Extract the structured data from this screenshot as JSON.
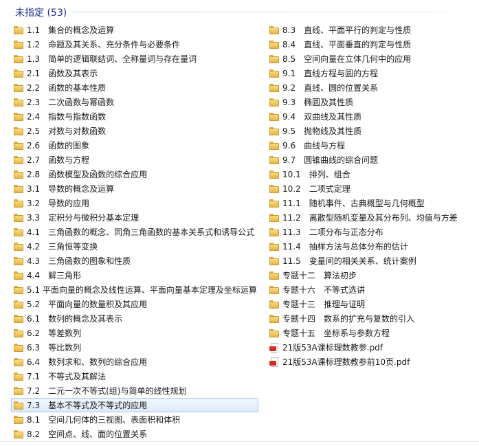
{
  "group": {
    "title": "未指定 (53)"
  },
  "left_items": [
    {
      "type": "folder",
      "label": "1.1　集合的概念及运算"
    },
    {
      "type": "folder",
      "label": "1.2　命题及其关系、充分条件与必要条件"
    },
    {
      "type": "folder",
      "label": "1.3　简单的逻辑联结词、全称量词与存在量词"
    },
    {
      "type": "folder",
      "label": "2.1　函数及其表示"
    },
    {
      "type": "folder",
      "label": "2.2　函数的基本性质"
    },
    {
      "type": "folder",
      "label": "2.3　二次函数与幂函数"
    },
    {
      "type": "folder",
      "label": "2.4　指数与指数函数"
    },
    {
      "type": "folder",
      "label": "2.5　对数与对数函数"
    },
    {
      "type": "folder",
      "label": "2.6　函数的图象"
    },
    {
      "type": "folder",
      "label": "2.7　函数与方程"
    },
    {
      "type": "folder",
      "label": "2.8　函数模型及函数的综合应用"
    },
    {
      "type": "folder",
      "label": "3.1　导数的概念及运算"
    },
    {
      "type": "folder",
      "label": "3.2　导数的应用"
    },
    {
      "type": "folder",
      "label": "3.3　定积分与微积分基本定理"
    },
    {
      "type": "folder",
      "label": "4.1　三角函数的概念、同角三角函数的基本关系式和诱导公式"
    },
    {
      "type": "folder",
      "label": "4.2　三角恒等变换"
    },
    {
      "type": "folder",
      "label": "4.3　三角函数的图象和性质"
    },
    {
      "type": "folder",
      "label": "4.4　解三角形"
    },
    {
      "type": "folder",
      "label": "5.1 平面向量的概念及线性运算、平面向量基本定理及坐标运算"
    },
    {
      "type": "folder",
      "label": "5.2　平面向量的数量积及其应用"
    },
    {
      "type": "folder",
      "label": "6.1　数列的概念及其表示"
    },
    {
      "type": "folder",
      "label": "6.2　等差数列"
    },
    {
      "type": "folder",
      "label": "6.3　等比数列"
    },
    {
      "type": "folder",
      "label": "6.4　数列求和、数列的综合应用"
    },
    {
      "type": "folder",
      "label": "7.1　不等式及其解法"
    },
    {
      "type": "folder",
      "label": "7.2　二元一次不等式(组)与简单的线性规划"
    },
    {
      "type": "folder",
      "label": "7.3　基本不等式及不等式的应用",
      "selected": true
    },
    {
      "type": "folder",
      "label": "8.1　空间几何体的三视图、表面积和体积"
    },
    {
      "type": "folder",
      "label": "8.2　空间点、线、面的位置关系"
    }
  ],
  "right_items": [
    {
      "type": "folder",
      "label": "8.3　直线、平面平行的判定与性质"
    },
    {
      "type": "folder",
      "label": "8.4　直线、平面垂直的判定与性质"
    },
    {
      "type": "folder",
      "label": "8.5　空间向量在立体几何中的应用"
    },
    {
      "type": "folder",
      "label": "9.1　直线方程与圆的方程"
    },
    {
      "type": "folder",
      "label": "9.2　直线、圆的位置关系"
    },
    {
      "type": "folder",
      "label": "9.3　椭圆及其性质"
    },
    {
      "type": "folder",
      "label": "9.4　双曲线及其性质"
    },
    {
      "type": "folder",
      "label": "9.5　抛物线及其性质"
    },
    {
      "type": "folder",
      "label": "9.6　曲线与方程"
    },
    {
      "type": "folder",
      "label": "9.7　圆锥曲线的综合问题"
    },
    {
      "type": "folder",
      "label": "10.1　排列、组合"
    },
    {
      "type": "folder",
      "label": "10.2　二项式定理"
    },
    {
      "type": "folder",
      "label": "11.1　随机事件、古典概型与几何概型"
    },
    {
      "type": "folder",
      "label": "11.2　离散型随机变量及其分布列、均值与方差"
    },
    {
      "type": "folder",
      "label": "11.3　二项分布与正态分布"
    },
    {
      "type": "folder",
      "label": "11.4　抽样方法与总体分布的估计"
    },
    {
      "type": "folder",
      "label": "11.5　变量间的相关关系、统计案例"
    },
    {
      "type": "folder",
      "label": "专题十二　算法初步"
    },
    {
      "type": "folder",
      "label": "专题十六　不等式选讲"
    },
    {
      "type": "folder",
      "label": "专题十三　推理与证明"
    },
    {
      "type": "folder",
      "label": "专题十四　数系的扩充与复数的引入"
    },
    {
      "type": "folder",
      "label": "专题十五　坐标系与参数方程"
    },
    {
      "type": "pdf",
      "label": "21版53A课标理数教参.pdf"
    },
    {
      "type": "pdf",
      "label": "21版53A课标理数教参前10页.pdf"
    }
  ]
}
